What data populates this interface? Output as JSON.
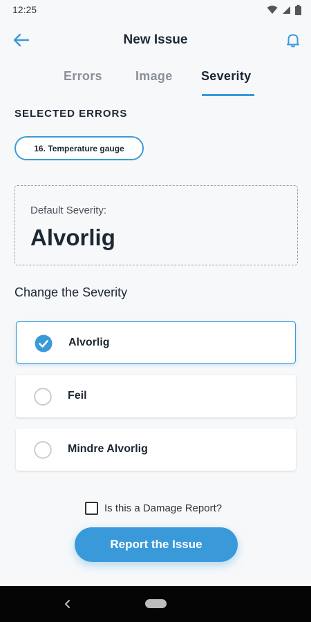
{
  "status_bar": {
    "time": "12:25"
  },
  "app_bar": {
    "title": "New Issue",
    "icons": [
      "arrow-left-icon",
      "bell-icon"
    ]
  },
  "tabs": [
    {
      "label": "Errors",
      "active": false
    },
    {
      "label": "Image",
      "active": false
    },
    {
      "label": "Severity",
      "active": true
    }
  ],
  "selected_errors": {
    "heading": "SELECTED ERRORS",
    "chips": [
      "16. Temperature gauge"
    ]
  },
  "default_severity": {
    "label": "Default Severity:",
    "value": "Alvorlig"
  },
  "change_severity": {
    "heading": "Change the Severity",
    "options": [
      {
        "label": "Alvorlig",
        "selected": true
      },
      {
        "label": "Feil",
        "selected": false
      },
      {
        "label": "Mindre Alvorlig",
        "selected": false
      }
    ]
  },
  "damage_report": {
    "label": "Is this a Damage Report?",
    "checked": false
  },
  "report_button": {
    "label": "Report the Issue"
  },
  "colors": {
    "accent": "#3a9ad9",
    "text": "#1c2733",
    "background": "#f6f8fa",
    "nav_bar": "#050505"
  }
}
